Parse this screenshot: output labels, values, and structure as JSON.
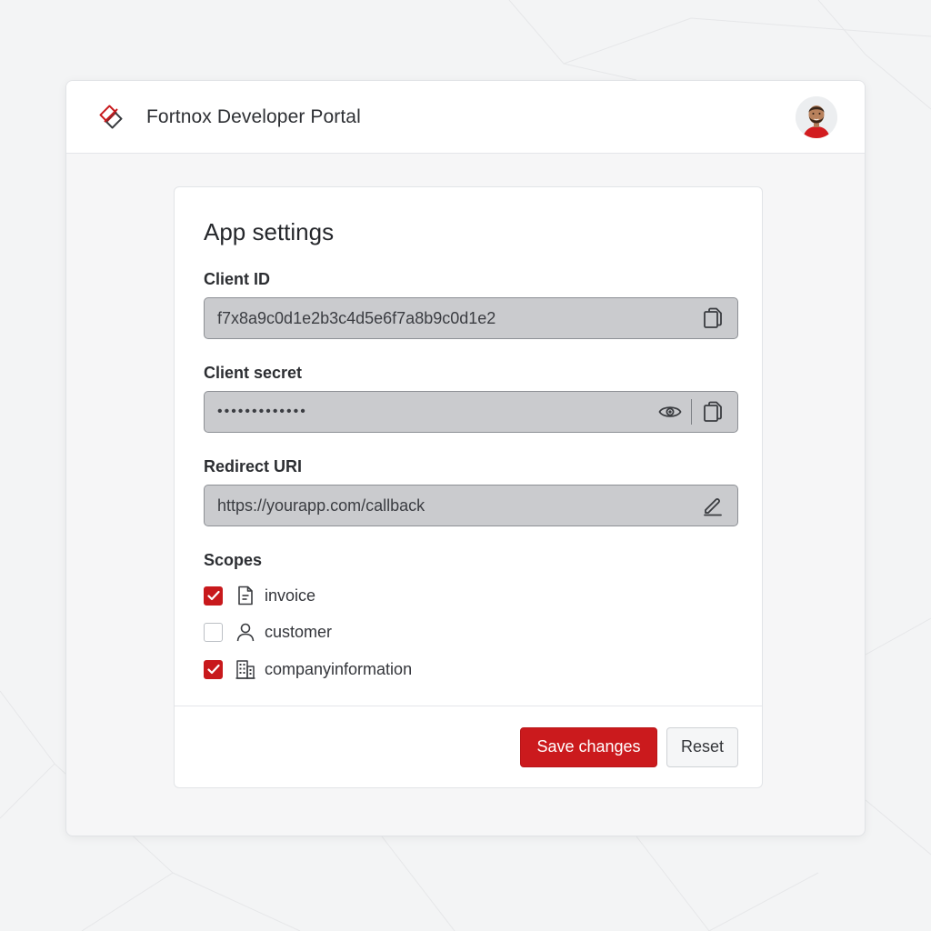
{
  "header": {
    "title": "Fortnox Developer Portal"
  },
  "settings": {
    "title": "App settings",
    "client_id": {
      "label": "Client ID",
      "value": "f7x8a9c0d1e2b3c4d5e6f7a8b9c0d1e2"
    },
    "client_secret": {
      "label": "Client secret",
      "value": "•••••••••••••"
    },
    "redirect_uri": {
      "label": "Redirect URI",
      "value": "https://yourapp.com/callback"
    },
    "scopes": {
      "label": "Scopes",
      "items": [
        {
          "label": "invoice",
          "checked": true,
          "icon": "document-icon"
        },
        {
          "label": "customer",
          "checked": false,
          "icon": "person-icon"
        },
        {
          "label": "companyinformation",
          "checked": true,
          "icon": "building-icon"
        }
      ]
    }
  },
  "footer": {
    "save_label": "Save changes",
    "reset_label": "Reset"
  },
  "colors": {
    "accent": "#cb1a1d",
    "field_bg": "#cacbce",
    "page_bg": "#f3f4f5"
  }
}
